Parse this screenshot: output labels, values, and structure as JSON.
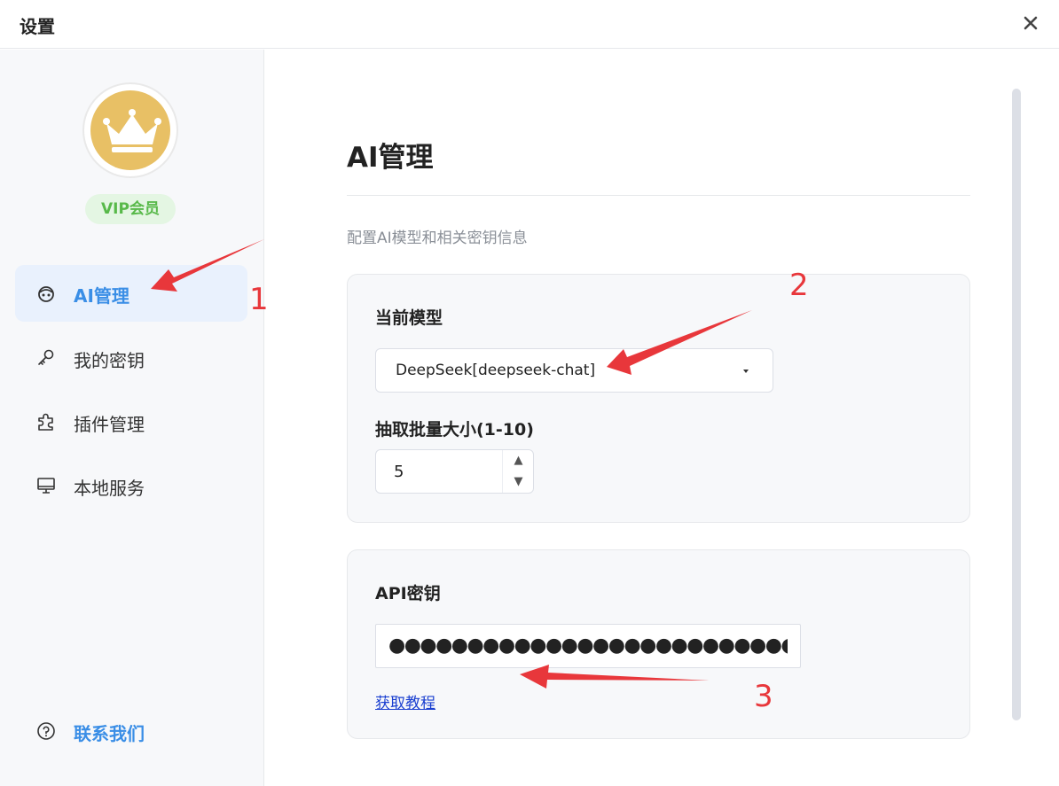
{
  "window": {
    "title": "设置"
  },
  "sidebar": {
    "badge": "VIP会员",
    "items": [
      {
        "label": "AI管理",
        "icon": "robot-icon",
        "active": true
      },
      {
        "label": "我的密钥",
        "icon": "key-icon"
      },
      {
        "label": "插件管理",
        "icon": "puzzle-icon"
      },
      {
        "label": "本地服务",
        "icon": "monitor-icon"
      }
    ],
    "contact": {
      "label": "联系我们",
      "icon": "help-circle-icon"
    }
  },
  "main": {
    "title": "AI管理",
    "subtitle": "配置AI模型和相关密钥信息",
    "model": {
      "label": "当前模型",
      "value": "DeepSeek[deepseek-chat]"
    },
    "batch": {
      "label": "抽取批量大小(1-10)",
      "value": "5"
    },
    "api": {
      "label": "API密钥",
      "value": "●●●●●●●●●●●●●●●●●●●●●●●●●●●●●●●●●●●",
      "link": "获取教程"
    }
  },
  "annotations": {
    "labels": [
      "1",
      "2",
      "3"
    ]
  },
  "colors": {
    "accent": "#3a8ee6",
    "vip_text": "#58b94a",
    "vip_bg": "#e4f6e3",
    "crown_bg": "#e8c065",
    "annotation": "#e8373b"
  }
}
